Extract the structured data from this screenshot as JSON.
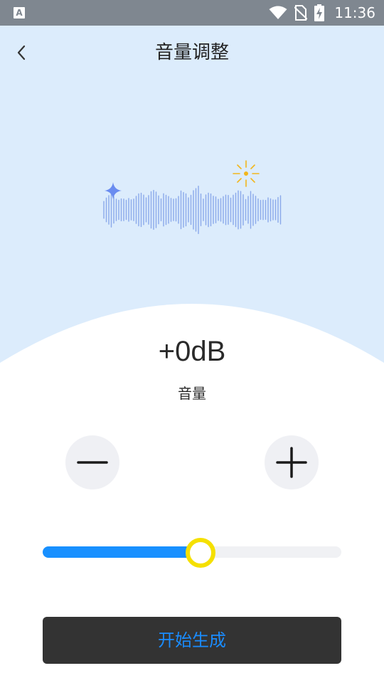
{
  "status_bar": {
    "time": "11:36",
    "left_icon_glyph": "A",
    "icons": [
      "wifi-icon",
      "no-sim-icon",
      "battery-charging-icon"
    ]
  },
  "header": {
    "title": "音量调整",
    "back_icon": "chevron-left-icon"
  },
  "volume": {
    "value": "+0dB",
    "label": "音量",
    "slider_level": 0.5
  },
  "controls": {
    "decrease_icon": "minus-icon",
    "increase_icon": "plus-icon"
  },
  "action": {
    "generate_label": "开始生成"
  },
  "colors": {
    "top_background": "#dcecfc",
    "accent_blue": "#1890ff",
    "thumb_yellow": "#f5e000",
    "button_dark": "#333333",
    "wave_blue": "#8aa9ea",
    "sparkle_yellow": "#f2b61c"
  }
}
